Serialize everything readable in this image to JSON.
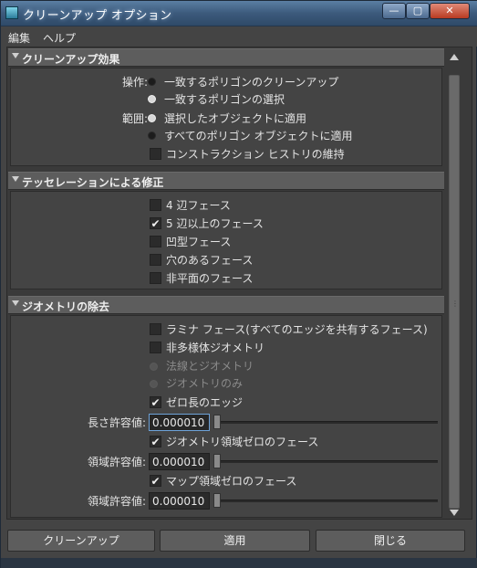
{
  "window": {
    "title": "クリーンアップ オプション",
    "buttons": {
      "minimize": "—",
      "maximize": "▢",
      "close": "✕"
    }
  },
  "menu": {
    "items": [
      "編集",
      "ヘルプ"
    ]
  },
  "sections": {
    "cleanup_effect": {
      "title": "クリーンアップ効果",
      "operation_label": "操作:",
      "operation_options": [
        "一致するポリゴンのクリーンアップ",
        "一致するポリゴンの選択"
      ],
      "operation_selected": 0,
      "scope_label": "範囲:",
      "scope_options": [
        "選択したオブジェクトに適用",
        "すべてのポリゴン オブジェクトに適用"
      ],
      "scope_selected": 0,
      "keep_history": {
        "label": "コンストラクション ヒストリの維持",
        "checked": false
      }
    },
    "tessellation": {
      "title": "テッセレーションによる修正",
      "items": [
        {
          "label": "4 辺フェース",
          "checked": false
        },
        {
          "label": "5 辺以上のフェース",
          "checked": true
        },
        {
          "label": "凹型フェース",
          "checked": false
        },
        {
          "label": "穴のあるフェース",
          "checked": false
        },
        {
          "label": "非平面のフェース",
          "checked": false
        }
      ]
    },
    "geometry_removal": {
      "title": "ジオメトリの除去",
      "lamina": {
        "label": "ラミナ フェース(すべてのエッジを共有するフェース)",
        "checked": false
      },
      "nonmanifold": {
        "label": "非多様体ジオメトリ",
        "checked": false
      },
      "normals_and_geometry": {
        "label": "法線とジオメトリ",
        "enabled": false
      },
      "geometry_only": {
        "label": "ジオメトリのみ",
        "enabled": false
      },
      "zero_length_edges": {
        "label": "ゼロ長のエッジ",
        "checked": true
      },
      "length_tolerance": {
        "label": "長さ許容値:",
        "value": "0.000010"
      },
      "zero_area_faces": {
        "label": "ジオメトリ領域ゼロのフェース",
        "checked": true
      },
      "area_tolerance": {
        "label": "領域許容値:",
        "value": "0.000010"
      },
      "zero_map_area_faces": {
        "label": "マップ領域ゼロのフェース",
        "checked": true
      },
      "map_area_tolerance": {
        "label": "領域許容値:",
        "value": "0.000010"
      }
    }
  },
  "footer": {
    "cleanup_label": "クリーンアップ",
    "apply_label": "適用",
    "close_label": "閉じる"
  },
  "colors": {
    "window_bg": "#444444",
    "section_header_bg": "#5d5d5d",
    "field_focus_border": "#6ea2d8",
    "titlebar": "#3c5a7c"
  }
}
